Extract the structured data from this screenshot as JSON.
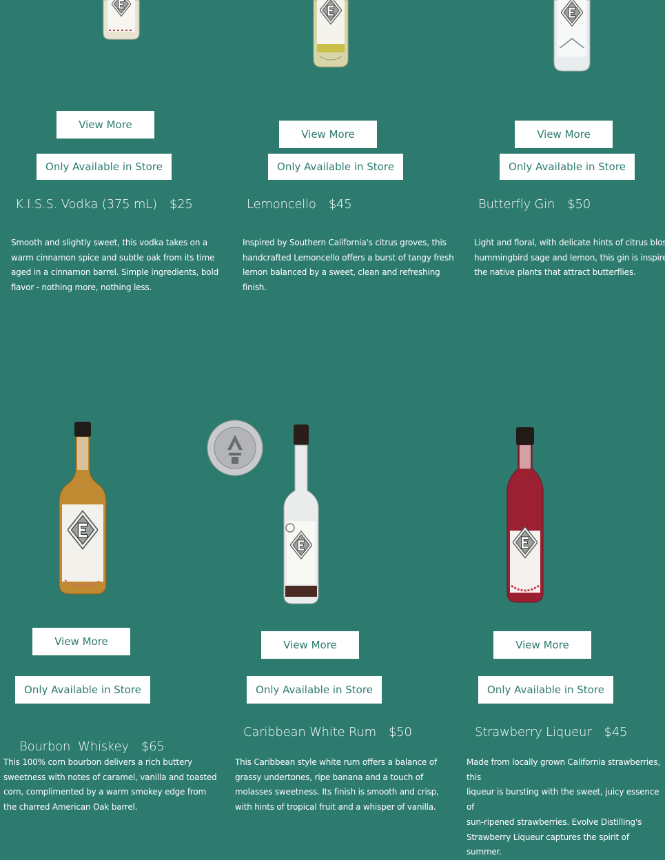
{
  "colors": {
    "background": "#2d7a6f",
    "button_bg": "#ffffff",
    "button_text": "#2d7a6f",
    "text": "#ffffff"
  },
  "products": [
    {
      "name": "K.I.S.S. Vodka (375 mL)",
      "price": "$25",
      "view_more": "View More",
      "availability": "Only Available in Store",
      "description_lines": [
        "Smooth and slightly sweet, this vodka takes on a",
        "warm cinnamon spice and subtle oak from its time",
        "aged in a cinnamon barrel. Simple ingredients, bold",
        "flavor - nothing more, nothing less."
      ]
    },
    {
      "name": "Lemoncello",
      "price": "$45",
      "view_more": "View More",
      "availability": "Only Available in Store",
      "description_lines": [
        "Inspired by Southern California's citrus groves, this",
        "handcrafted Lemoncello offers a burst of tangy fresh",
        "lemon balanced by a sweet, clean and refreshing",
        "finish."
      ]
    },
    {
      "name": "Butterfly Gin",
      "price": "$50",
      "view_more": "View More",
      "availability": "Only Available in Store",
      "description_lines": [
        "Light and floral, with delicate hints of citrus blossom,",
        "hummingbird sage and lemon, this gin is inspired by",
        "the native plants that attract butterflies."
      ]
    },
    {
      "name": "Bourbon  Whiskey",
      "price": "$65",
      "view_more": "View More",
      "availability": "Only Available in Store",
      "description_lines": [
        "This 100% corn bourbon delivers a rich buttery",
        "sweetness with notes of caramel, vanilla and toasted",
        "corn, complimented by a warm smokey edge from",
        "the charred American Oak barrel."
      ]
    },
    {
      "name": "Caribbean White Rum",
      "price": "$50",
      "view_more": "View More",
      "availability": "Only Available in Store",
      "description_lines": [
        "This Caribbean style white rum offers a balance of",
        "grassy undertones, ripe banana and a touch of",
        "molasses sweetness. Its finish is smooth and crisp,",
        "with hints of tropical fruit and a whisper of vanilla."
      ]
    },
    {
      "name": "Strawberry Liqueur",
      "price": "$45",
      "view_more": "View More",
      "availability": "Only Available in Store",
      "description_lines": [
        "Made from locally grown California strawberries, this",
        "liqueur is bursting with the sweet, juicy essence of",
        "sun-ripened strawberries. Evolve Distilling's",
        "Strawberry Liqueur captures the spirit of summer."
      ]
    }
  ]
}
